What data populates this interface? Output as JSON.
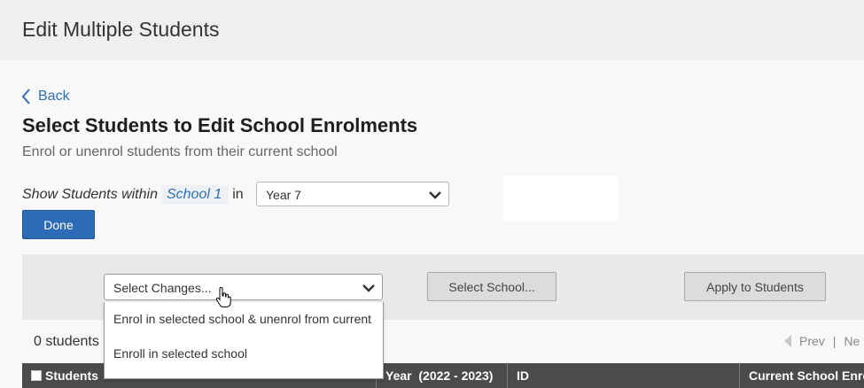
{
  "header": {
    "title": "Edit Multiple Students"
  },
  "nav": {
    "back_label": "Back"
  },
  "page": {
    "heading": "Select Students to Edit School Enrolments",
    "subheading": "Enrol or unenrol students from their current school"
  },
  "filter": {
    "label": "Show Students within",
    "school": "School 1",
    "in_label": "in",
    "year_value": "Year 7"
  },
  "buttons": {
    "done": "Done",
    "select_school": "Select School...",
    "apply": "Apply to Students"
  },
  "changes": {
    "placeholder": "Select Changes...",
    "options": [
      "Enrol in selected school & unenrol from current",
      "Enroll in selected school"
    ]
  },
  "summary": {
    "count_text": "0 students"
  },
  "pager": {
    "prev": "Prev",
    "separator": "|",
    "next": "Ne"
  },
  "table": {
    "columns": [
      "Students",
      "Year  (2022 - 2023)",
      "ID",
      "Current School Enrol"
    ]
  }
}
